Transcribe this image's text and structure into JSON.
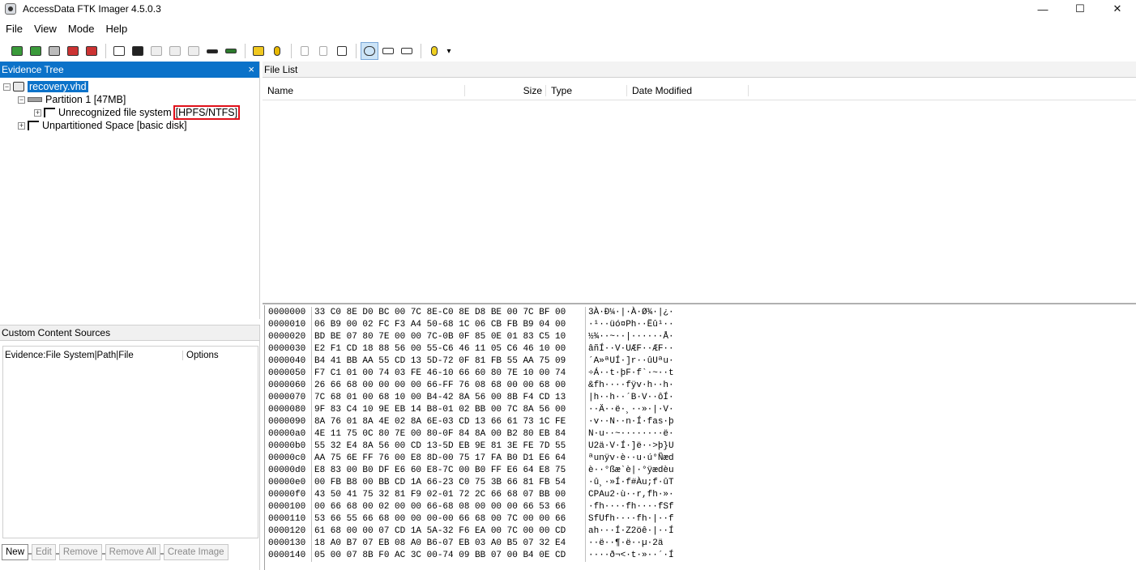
{
  "window": {
    "title": "AccessData FTK Imager 4.5.0.3",
    "controls": [
      "—",
      "☐",
      "✕"
    ]
  },
  "menu": [
    "File",
    "View",
    "Mode",
    "Help"
  ],
  "evidence_tree": {
    "title": "Evidence Tree",
    "close": "×",
    "nodes": {
      "root": "recovery.vhd",
      "partition": "Partition 1 [47MB]",
      "fs_label": "Unrecognized file system",
      "fs_type": "[HPFS/NTFS]",
      "unpartitioned": "Unpartitioned Space [basic disk]"
    }
  },
  "custom_content": {
    "title": "Custom Content Sources",
    "col1": "Evidence:File System|Path|File",
    "col2": "Options",
    "buttons": [
      "New",
      "Edit",
      "Remove",
      "Remove All",
      "Create Image"
    ]
  },
  "file_list": {
    "title": "File List",
    "columns": [
      "Name",
      "Size",
      "Type",
      "Date Modified"
    ]
  },
  "hex": [
    [
      "0000000",
      "33 C0 8E D0 BC 00 7C 8E-C0 8E D8 BE 00 7C BF 00",
      "3À·Ð¼·|·À·Ø¾·|¿·"
    ],
    [
      "0000010",
      "06 B9 00 02 FC F3 A4 50-68 1C 06 CB FB B9 04 00",
      "·¹··üó¤Ph··Ëû¹··"
    ],
    [
      "0000020",
      "BD BE 07 80 7E 00 00 7C-0B 0F 85 0E 01 83 C5 10",
      "½¾··~··|······Å·"
    ],
    [
      "0000030",
      "E2 F1 CD 18 88 56 00 55-C6 46 11 05 C6 46 10 00",
      "âñÍ··V·UÆF··ÆF··"
    ],
    [
      "0000040",
      "B4 41 BB AA 55 CD 13 5D-72 0F 81 FB 55 AA 75 09",
      "´A»ªUÍ·]r··ûUªu·"
    ],
    [
      "0000050",
      "F7 C1 01 00 74 03 FE 46-10 66 60 80 7E 10 00 74",
      "÷Á··t·þF·f`·~··t"
    ],
    [
      "0000060",
      "26 66 68 00 00 00 00 66-FF 76 08 68 00 00 68 00",
      "&fh····fÿv·h··h·"
    ],
    [
      "0000070",
      "7C 68 01 00 68 10 00 B4-42 8A 56 00 8B F4 CD 13",
      "|h··h··´B·V··ôÍ·"
    ],
    [
      "0000080",
      "9F 83 C4 10 9E EB 14 B8-01 02 BB 00 7C 8A 56 00",
      "··Ä··ë·¸··»·|·V·"
    ],
    [
      "0000090",
      "8A 76 01 8A 4E 02 8A 6E-03 CD 13 66 61 73 1C FE",
      "·v··N··n·Í·fas·þ"
    ],
    [
      "00000a0",
      "4E 11 75 0C 80 7E 00 80-0F 84 8A 00 B2 80 EB 84",
      "N·u··~········ë·"
    ],
    [
      "00000b0",
      "55 32 E4 8A 56 00 CD 13-5D EB 9E 81 3E FE 7D 55",
      "U2ä·V·Í·]ë··>þ}U"
    ],
    [
      "00000c0",
      "AA 75 6E FF 76 00 E8 8D-00 75 17 FA B0 D1 E6 64",
      "ªunÿv·è··u·ú°Ñæd"
    ],
    [
      "00000d0",
      "E8 83 00 B0 DF E6 60 E8-7C 00 B0 FF E6 64 E8 75",
      "è··°ßæ`è|·°ÿædèu"
    ],
    [
      "00000e0",
      "00 FB B8 00 BB CD 1A 66-23 C0 75 3B 66 81 FB 54",
      "·û¸·»Í·f#Àu;f·ûT"
    ],
    [
      "00000f0",
      "43 50 41 75 32 81 F9 02-01 72 2C 66 68 07 BB 00",
      "CPAu2·ù··r,fh·»·"
    ],
    [
      "0000100",
      "00 66 68 00 02 00 00 66-68 08 00 00 00 66 53 66",
      "·fh····fh····fSf"
    ],
    [
      "0000110",
      "53 66 55 66 68 00 00 00-00 66 68 00 7C 00 00 66",
      "SfUfh····fh·|··f"
    ],
    [
      "0000120",
      "61 68 00 00 07 CD 1A 5A-32 F6 EA 00 7C 00 00 CD",
      "ah···Í·Z2öê·|··Í"
    ],
    [
      "0000130",
      "18 A0 B7 07 EB 08 A0 B6-07 EB 03 A0 B5 07 32 E4",
      "··ë··¶·ë··µ·2ä"
    ],
    [
      "0000140",
      "05 00 07 8B F0 AC 3C 00-74 09 BB 07 00 B4 0E CD",
      "····ð¬<·t·»··´·Í"
    ]
  ]
}
